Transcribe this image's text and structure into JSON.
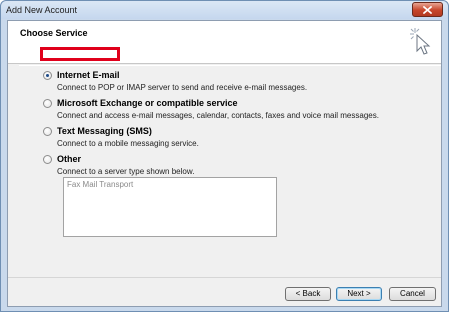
{
  "window": {
    "title": "Add New Account",
    "close_icon": "close-icon"
  },
  "header": {
    "title": "Choose Service",
    "icon": "cursor-sparkle-icon"
  },
  "options": [
    {
      "label": "Internet E-mail",
      "description": "Connect to POP or IMAP server to send and receive e-mail messages.",
      "checked": true
    },
    {
      "label": "Microsoft Exchange or compatible service",
      "description": "Connect and access e-mail messages, calendar, contacts, faxes and voice mail messages.",
      "checked": false
    },
    {
      "label": "Text Messaging (SMS)",
      "description": "Connect to a mobile messaging service.",
      "checked": false
    },
    {
      "label": "Other",
      "description": "Connect to a server type shown below.",
      "checked": false
    }
  ],
  "other_server_list": {
    "items": [
      "Fax Mail Transport"
    ]
  },
  "buttons": {
    "back": "< Back",
    "next": "Next >",
    "cancel": "Cancel"
  },
  "colors": {
    "highlight": "#e0001b",
    "title_bar": "#c9d9ec",
    "close_button": "#c7462b"
  }
}
